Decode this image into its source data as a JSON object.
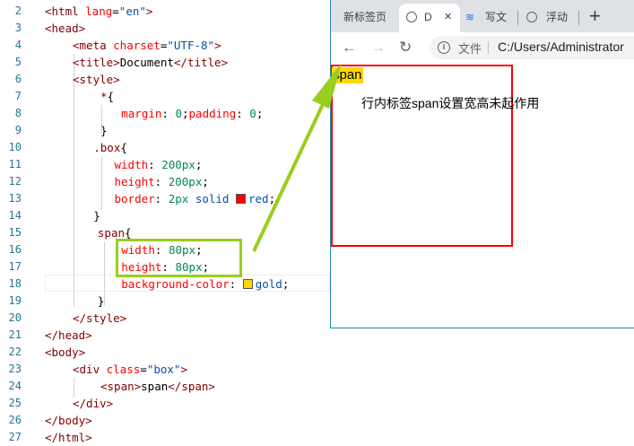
{
  "editor": {
    "lines": [
      {
        "n": "2",
        "segs": [
          [
            "t-tag",
            "<html "
          ],
          [
            "t-attr",
            "lang"
          ],
          [
            "t-txt",
            "="
          ],
          [
            "t-str",
            "\"en\""
          ],
          [
            "t-tag",
            ">"
          ]
        ],
        "indent": 0
      },
      {
        "n": "3",
        "segs": [
          [
            "t-tag",
            "<head>"
          ]
        ],
        "indent": 0
      },
      {
        "n": "4",
        "segs": [
          [
            "t-tag",
            "<meta "
          ],
          [
            "t-attr",
            "charset"
          ],
          [
            "t-txt",
            "="
          ],
          [
            "t-str",
            "\"UTF-8\""
          ],
          [
            "t-tag",
            ">"
          ]
        ],
        "indent": 1
      },
      {
        "n": "5",
        "segs": [
          [
            "t-tag",
            "<title>"
          ],
          [
            "t-txt",
            "Document"
          ],
          [
            "t-tag",
            "</title>"
          ]
        ],
        "indent": 1
      },
      {
        "n": "6",
        "segs": [
          [
            "t-tag",
            "<style>"
          ]
        ],
        "indent": 1
      },
      {
        "n": "7",
        "segs": [
          [
            "t-sel",
            "*"
          ],
          [
            "t-txt",
            "{"
          ]
        ],
        "indent": 2.0
      },
      {
        "n": "8",
        "segs": [
          [
            "t-prop",
            "margin"
          ],
          [
            "t-txt",
            ": "
          ],
          [
            "t-num",
            "0"
          ],
          [
            "t-txt",
            ";"
          ],
          [
            "t-prop",
            "padding"
          ],
          [
            "t-txt",
            ": "
          ],
          [
            "t-num",
            "0"
          ],
          [
            "t-txt",
            ";"
          ]
        ],
        "indent": 2.75
      },
      {
        "n": "9",
        "segs": [
          [
            "t-txt",
            "}"
          ]
        ],
        "indent": 2.0
      },
      {
        "n": "10",
        "segs": [
          [
            "t-sel",
            ".box"
          ],
          [
            "t-txt",
            "{"
          ]
        ],
        "indent": 1.75
      },
      {
        "n": "11",
        "segs": [
          [
            "t-prop",
            "width"
          ],
          [
            "t-txt",
            ": "
          ],
          [
            "t-num",
            "200px"
          ],
          [
            "t-txt",
            ";"
          ]
        ],
        "indent": 2.5
      },
      {
        "n": "12",
        "segs": [
          [
            "t-prop",
            "height"
          ],
          [
            "t-txt",
            ": "
          ],
          [
            "t-num",
            "200px"
          ],
          [
            "t-txt",
            ";"
          ]
        ],
        "indent": 2.5
      },
      {
        "n": "13",
        "segs": [
          [
            "t-prop",
            "border"
          ],
          [
            "t-txt",
            ": "
          ],
          [
            "t-num",
            "2px"
          ],
          [
            "t-txt",
            " "
          ],
          [
            "t-val",
            "solid"
          ],
          [
            "t-txt",
            " "
          ],
          [
            "swatch",
            "#ff0000"
          ],
          [
            "t-val",
            "red"
          ],
          [
            "t-txt",
            ";"
          ]
        ],
        "indent": 2.5
      },
      {
        "n": "14",
        "segs": [
          [
            "t-txt",
            "}"
          ]
        ],
        "indent": 1.75
      },
      {
        "n": "15",
        "segs": [
          [
            "t-sel",
            "span"
          ],
          [
            "t-txt",
            "{"
          ]
        ],
        "indent": 1.9
      },
      {
        "n": "16",
        "segs": [
          [
            "t-prop",
            "width"
          ],
          [
            "t-txt",
            ": "
          ],
          [
            "t-num",
            "80px"
          ],
          [
            "t-txt",
            ";"
          ]
        ],
        "indent": 2.75
      },
      {
        "n": "17",
        "segs": [
          [
            "t-prop",
            "height"
          ],
          [
            "t-txt",
            ": "
          ],
          [
            "t-num",
            "80px"
          ],
          [
            "t-txt",
            ";"
          ]
        ],
        "indent": 2.75
      },
      {
        "n": "18",
        "segs": [
          [
            "t-prop",
            "background-color"
          ],
          [
            "t-txt",
            ": "
          ],
          [
            "swatch",
            "#ffd700"
          ],
          [
            "t-val",
            "gold"
          ],
          [
            "t-txt",
            ";"
          ]
        ],
        "indent": 2.75
      },
      {
        "n": "19",
        "segs": [
          [
            "t-txt",
            "}"
          ]
        ],
        "indent": 1.9
      },
      {
        "n": "20",
        "segs": [
          [
            "t-tag",
            "</style>"
          ]
        ],
        "indent": 1
      },
      {
        "n": "21",
        "segs": [
          [
            "t-tag",
            "</head>"
          ]
        ],
        "indent": 0
      },
      {
        "n": "22",
        "segs": [
          [
            "t-tag",
            "<body>"
          ]
        ],
        "indent": 0
      },
      {
        "n": "23",
        "segs": [
          [
            "t-tag",
            "<div "
          ],
          [
            "t-attr",
            "class"
          ],
          [
            "t-txt",
            "="
          ],
          [
            "t-str",
            "\"box\""
          ],
          [
            "t-tag",
            ">"
          ]
        ],
        "indent": 1
      },
      {
        "n": "24",
        "segs": [
          [
            "t-tag",
            "<span>"
          ],
          [
            "t-txt",
            "span"
          ],
          [
            "t-tag",
            "</span>"
          ]
        ],
        "indent": 2
      },
      {
        "n": "25",
        "segs": [
          [
            "t-tag",
            "</div>"
          ]
        ],
        "indent": 1
      },
      {
        "n": "26",
        "segs": [
          [
            "t-tag",
            "</body>"
          ]
        ],
        "indent": 0
      },
      {
        "n": "27",
        "segs": [
          [
            "t-tag",
            "</html>"
          ]
        ],
        "indent": 0
      }
    ]
  },
  "browser": {
    "tabs": [
      {
        "label": "新标签页",
        "active": false
      },
      {
        "label": "D",
        "active": true
      },
      {
        "label": "写文",
        "active": false
      },
      {
        "label": "浮动",
        "active": false
      }
    ],
    "new_tab_symbol": "+",
    "close_symbol": "✕",
    "address_prefix": "文件",
    "address": "C:/Users/Administrator",
    "page": {
      "span_text": "span",
      "note": "行内标签span设置宽高未起作用"
    }
  },
  "colors": {
    "box_border": "#ff0000",
    "span_bg": "#ffd700",
    "annotation": "#9acd1f"
  }
}
